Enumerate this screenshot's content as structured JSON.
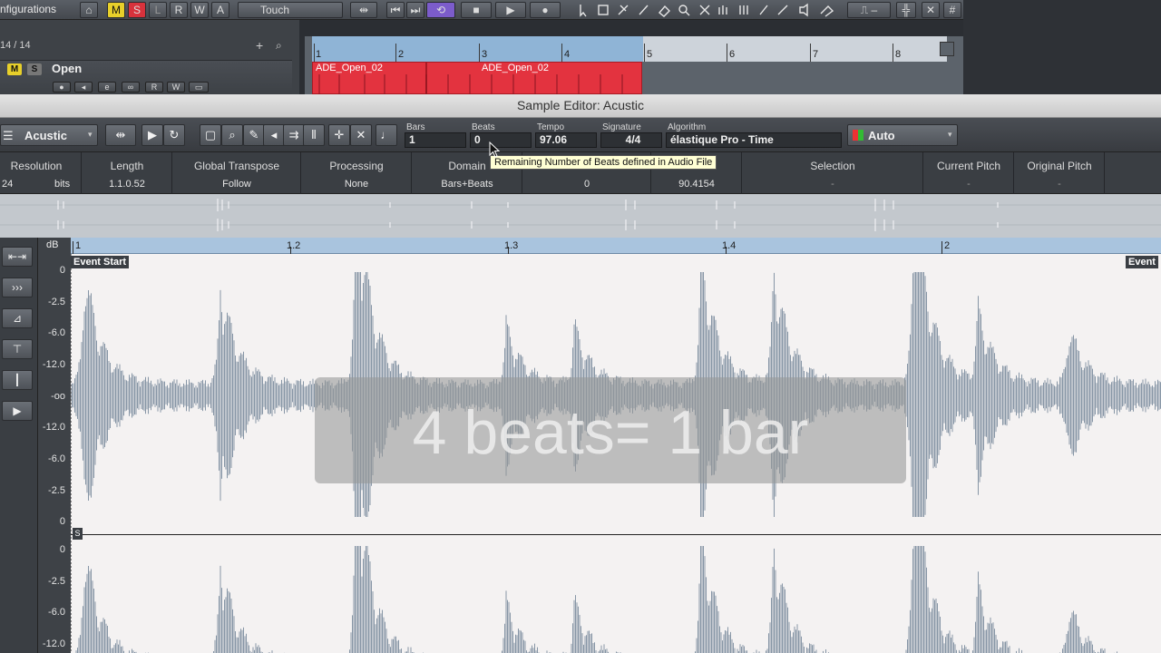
{
  "project": {
    "configurations_label": "nfigurations",
    "automation_mode": "Touch",
    "transport": [
      "⏮",
      "⏭",
      "⟲",
      "■",
      "▶",
      "●"
    ],
    "track_count": "14 / 14",
    "track": {
      "mute": "M",
      "solo": "S",
      "name": "Open"
    },
    "toolbar_buttons": {
      "m": "M",
      "s": "S",
      "l": "L",
      "r": "R",
      "w": "W",
      "a": "A"
    },
    "ruler_numbers": [
      "1",
      "2",
      "3",
      "4",
      "5",
      "6",
      "7",
      "8"
    ],
    "parts": [
      "ADE_Open_02",
      "ADE_Open_02"
    ]
  },
  "editor": {
    "title": "Sample Editor: Acustic",
    "name": "Acustic",
    "fields": {
      "bars": {
        "label": "Bars",
        "value": "1"
      },
      "beats": {
        "label": "Beats",
        "value": "0"
      },
      "tempo": {
        "label": "Tempo",
        "value": "97.06"
      },
      "signature": {
        "label": "Signature",
        "value": "4/4"
      },
      "algorithm": {
        "label": "Algorithm",
        "value": "élastique Pro - Time"
      }
    },
    "auto_label": "Auto",
    "tooltip": "Remaining Number of Beats defined in Audio File",
    "info": {
      "resolution": {
        "label": "Resolution",
        "value": "24",
        "unit": "bits"
      },
      "length": {
        "label": "Length",
        "value": "1.1.0.52"
      },
      "global_transpose": {
        "label": "Global Transpose",
        "value": "Follow"
      },
      "processing": {
        "label": "Processing",
        "value": "None"
      },
      "domain": {
        "label": "Domain",
        "value": "Bars+Beats"
      },
      "unnamed_value_1": "0",
      "unnamed_value_2": "90.4154",
      "selection": {
        "label": "Selection",
        "value": "-"
      },
      "current_pitch": {
        "label": "Current Pitch",
        "value": "-"
      },
      "original_pitch": {
        "label": "Original Pitch",
        "value": "-"
      }
    },
    "ruler": [
      "1",
      "1.2",
      "1.3",
      "1.4",
      "2"
    ],
    "db_label": "dB",
    "db_scale": [
      "0",
      "-2.5",
      "-6.0",
      "-12.0",
      "-oo",
      "-12.0",
      "-6.0",
      "-2.5",
      "0"
    ],
    "db_scale_lower": [
      "0",
      "-2.5",
      "-6.0",
      "-12.0"
    ],
    "event_start": "Event Start",
    "event_end": "Event",
    "s_badge": "S",
    "overlay_text": "4 beats= 1 bar"
  },
  "colors": {
    "part_red": "#e3333f",
    "cycle_blue": "#8fb4d6",
    "wave": "#8796a6",
    "tooltip_bg": "#ffffd4"
  }
}
